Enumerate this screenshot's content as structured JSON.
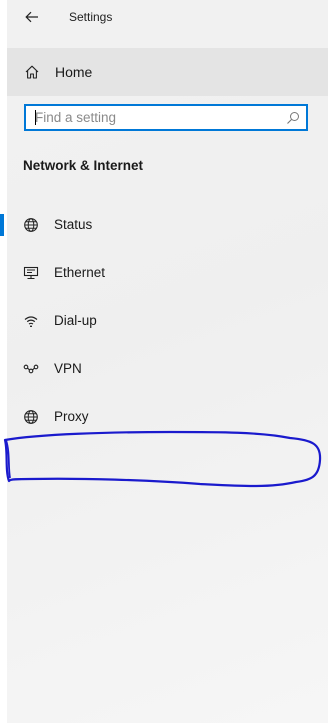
{
  "window": {
    "title": "Settings",
    "back_icon": "arrow-left-icon"
  },
  "home": {
    "label": "Home",
    "icon": "home-icon"
  },
  "search": {
    "placeholder": "Find a setting",
    "value": "",
    "icon": "search-icon",
    "border_color": "#0078d7"
  },
  "section": {
    "title": "Network & Internet"
  },
  "nav": {
    "items": [
      {
        "label": "Status",
        "icon": "globe-icon",
        "selected": true
      },
      {
        "label": "Ethernet",
        "icon": "ethernet-icon",
        "selected": false
      },
      {
        "label": "Dial-up",
        "icon": "dialup-icon",
        "selected": false
      },
      {
        "label": "VPN",
        "icon": "vpn-icon",
        "selected": false
      },
      {
        "label": "Proxy",
        "icon": "globe-icon",
        "selected": false
      }
    ]
  },
  "colors": {
    "accent": "#0078d7",
    "annotation_stroke": "#1a1acd"
  }
}
